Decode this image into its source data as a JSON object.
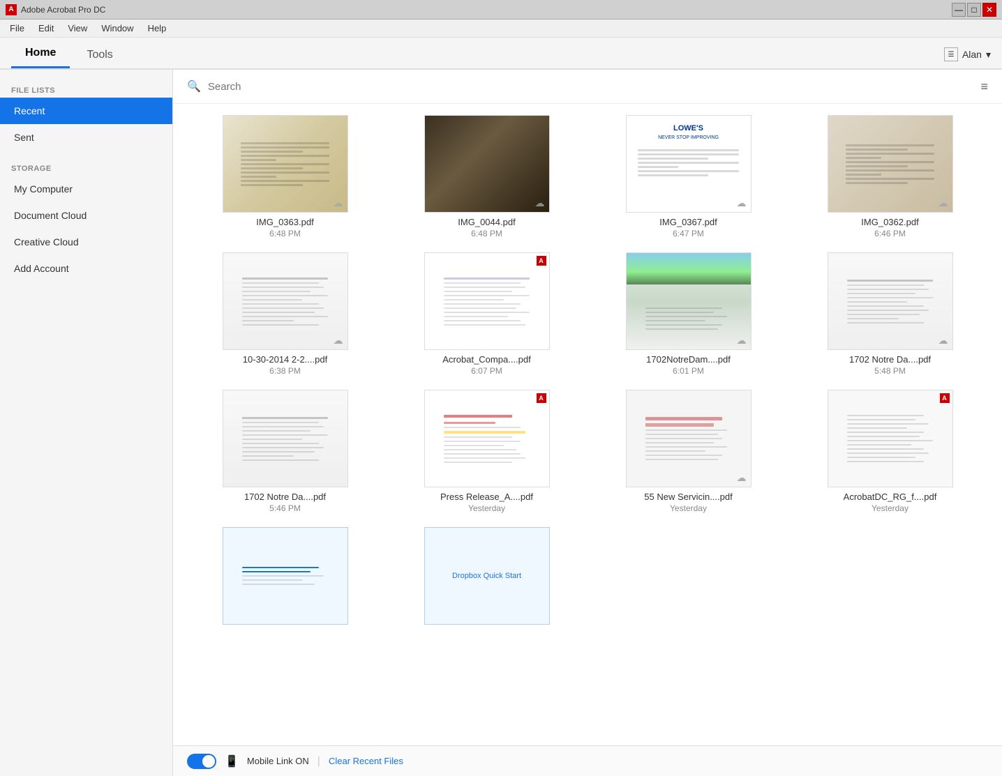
{
  "app": {
    "title": "Adobe Acrobat Pro DC",
    "icon": "A"
  },
  "window_controls": {
    "minimize": "—",
    "maximize": "□",
    "close": "✕"
  },
  "menu": {
    "items": [
      "File",
      "Edit",
      "View",
      "Window",
      "Help"
    ]
  },
  "tabs": {
    "items": [
      {
        "label": "Home",
        "active": true
      },
      {
        "label": "Tools",
        "active": false
      }
    ],
    "user": "Alan"
  },
  "sidebar": {
    "file_lists_label": "FILE LISTS",
    "storage_label": "STORAGE",
    "file_list_items": [
      {
        "label": "Recent",
        "active": true
      },
      {
        "label": "Sent",
        "active": false
      }
    ],
    "storage_items": [
      {
        "label": "My Computer"
      },
      {
        "label": "Document Cloud"
      },
      {
        "label": "Creative Cloud"
      },
      {
        "label": "Add Account"
      }
    ]
  },
  "search": {
    "placeholder": "Search"
  },
  "files": [
    {
      "name": "IMG_0363.pdf",
      "time": "6:48 PM",
      "has_cloud": true,
      "type": "receipt1",
      "has_adobe": false
    },
    {
      "name": "IMG_0044.pdf",
      "time": "6:48 PM",
      "has_cloud": true,
      "type": "dark_doc",
      "has_adobe": false
    },
    {
      "name": "IMG_0367.pdf",
      "time": "6:47 PM",
      "has_cloud": true,
      "type": "lowes",
      "has_adobe": false
    },
    {
      "name": "IMG_0362.pdf",
      "time": "6:46 PM",
      "has_cloud": true,
      "type": "receipt2",
      "has_adobe": false
    },
    {
      "name": "10-30-2014 2-2....pdf",
      "time": "6:38 PM",
      "has_cloud": true,
      "type": "form",
      "has_adobe": false
    },
    {
      "name": "Acrobat_Compa....pdf",
      "time": "6:07 PM",
      "has_cloud": false,
      "type": "acrobat",
      "has_adobe": true
    },
    {
      "name": "1702NotreDam....pdf",
      "time": "6:01 PM",
      "has_cloud": true,
      "type": "notredame",
      "has_adobe": false
    },
    {
      "name": "1702 Notre Da....pdf",
      "time": "5:48 PM",
      "has_cloud": true,
      "type": "document",
      "has_adobe": false
    },
    {
      "name": "1702 Notre Da....pdf",
      "time": "5:46 PM",
      "has_cloud": false,
      "type": "document2",
      "has_adobe": false
    },
    {
      "name": "Press Release_A....pdf",
      "time": "Yesterday",
      "has_cloud": false,
      "type": "pressrelease",
      "has_adobe": true
    },
    {
      "name": "55 New Servicin....pdf",
      "time": "Yesterday",
      "has_cloud": true,
      "type": "servicing",
      "has_adobe": false
    },
    {
      "name": "AcrobatDC_RG_f....pdf",
      "time": "Yesterday",
      "has_cloud": false,
      "type": "acrobatdc",
      "has_adobe": true
    },
    {
      "name": "",
      "time": "",
      "has_cloud": false,
      "type": "dropbox",
      "has_adobe": false
    }
  ],
  "bottom_bar": {
    "mobile_link_text": "Mobile Link ON",
    "separator": "|",
    "clear_recent": "Clear Recent Files"
  },
  "dropbox_text": "Dropbox Quick Start"
}
